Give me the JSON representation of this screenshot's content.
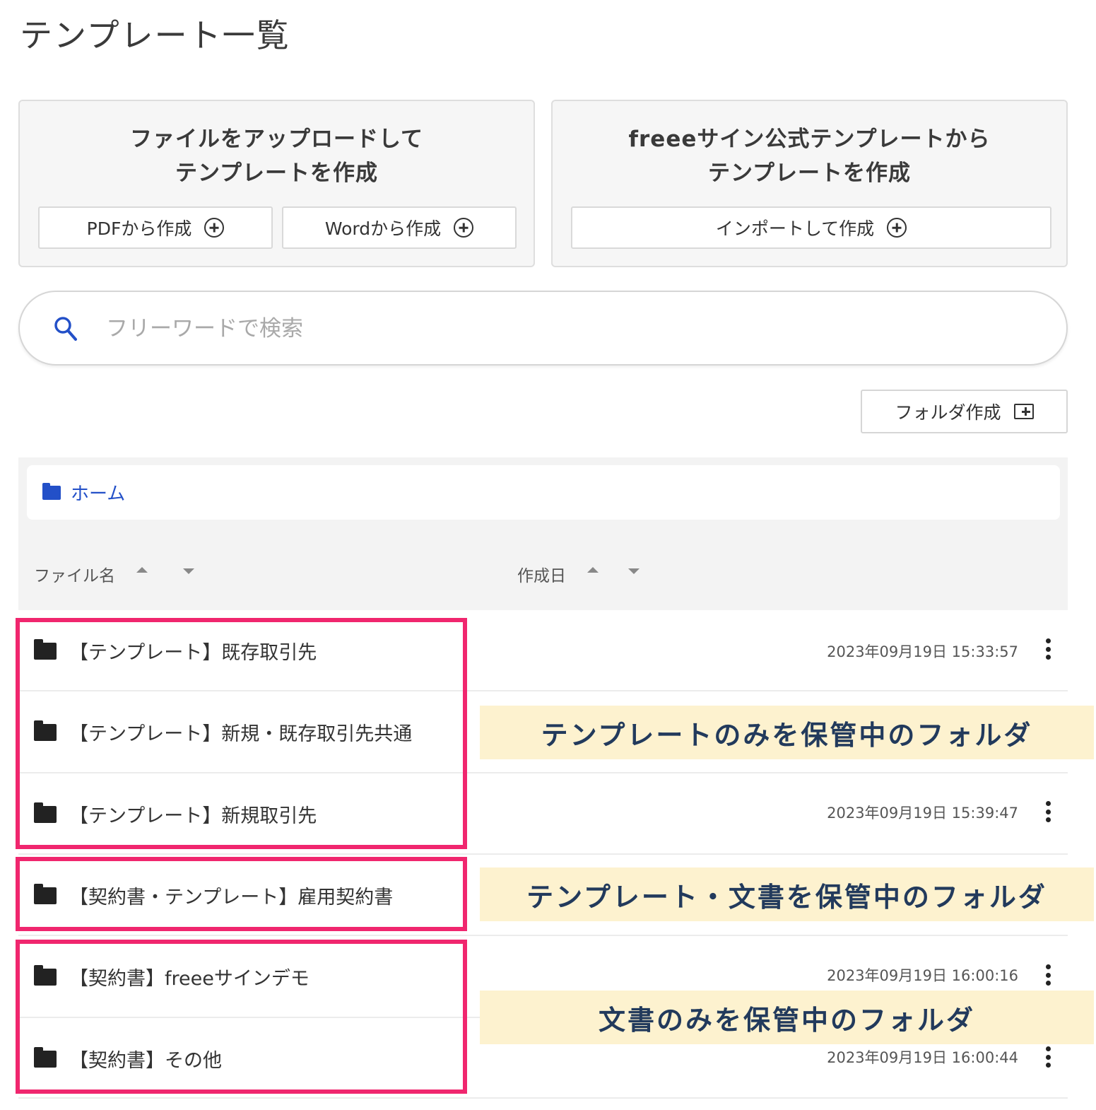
{
  "page_title": "テンプレート一覧",
  "upload_card": {
    "title_line1": "ファイルをアップロードして",
    "title_line2": "テンプレートを作成",
    "pdf_button": "PDFから作成",
    "word_button": "Wordから作成"
  },
  "official_card": {
    "title_line1": "freeeサイン公式テンプレートから",
    "title_line2": "テンプレートを作成",
    "import_button": "インポートして作成"
  },
  "search": {
    "placeholder": "フリーワードで検索",
    "value": ""
  },
  "create_folder_button": "フォルダ作成",
  "breadcrumb": {
    "home": "ホーム"
  },
  "columns": {
    "name": "ファイル名",
    "date": "作成日"
  },
  "rows": [
    {
      "name": "【テンプレート】既存取引先",
      "date": "2023年09月19日 15:33:57"
    },
    {
      "name": "【テンプレート】新規・既存取引先共通",
      "date": ""
    },
    {
      "name": "【テンプレート】新規取引先",
      "date": "2023年09月19日 15:39:47"
    },
    {
      "name": "【契約書・テンプレート】雇用契約書",
      "date": ""
    },
    {
      "name": "【契約書】freeeサインデモ",
      "date": "2023年09月19日 16:00:16"
    },
    {
      "name": "【契約書】その他",
      "date": "2023年09月19日 16:00:44"
    }
  ],
  "callouts": {
    "template_only": "テンプレートのみを保管中のフォルダ",
    "template_and_docs": "テンプレート・文書を保管中のフォルダ",
    "docs_only": "文書のみを保管中のフォルダ"
  },
  "colors": {
    "highlight": "#f0266e",
    "callout_bg": "#fdf2cf",
    "link_blue": "#2350c8"
  }
}
